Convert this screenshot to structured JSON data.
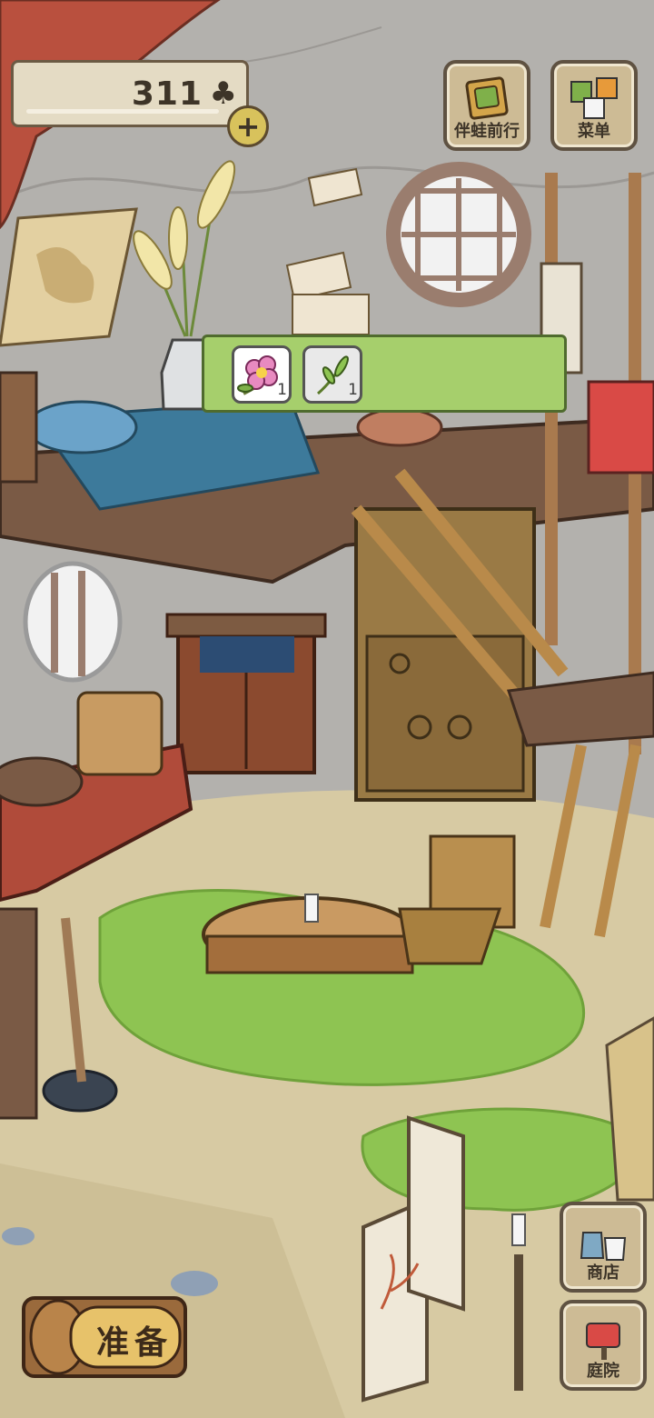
{
  "hud": {
    "clover_count": "311",
    "clover_icon": "clover-icon",
    "add_icon": "plus-icon"
  },
  "menu": {
    "travel_label": "伴蛙前行",
    "menu_label": "菜单"
  },
  "items": [
    {
      "name": "flower-icon",
      "qty": "1",
      "selected": true
    },
    {
      "name": "sprout-icon",
      "qty": "1",
      "selected": false
    }
  ],
  "side_buttons": {
    "shop_label": "商店",
    "garden_label": "庭院"
  },
  "prepare": {
    "label": "准备"
  },
  "colors": {
    "item_strip": "#a6cf6c",
    "button_face": "#cdbb95",
    "outline": "#5f5242"
  }
}
